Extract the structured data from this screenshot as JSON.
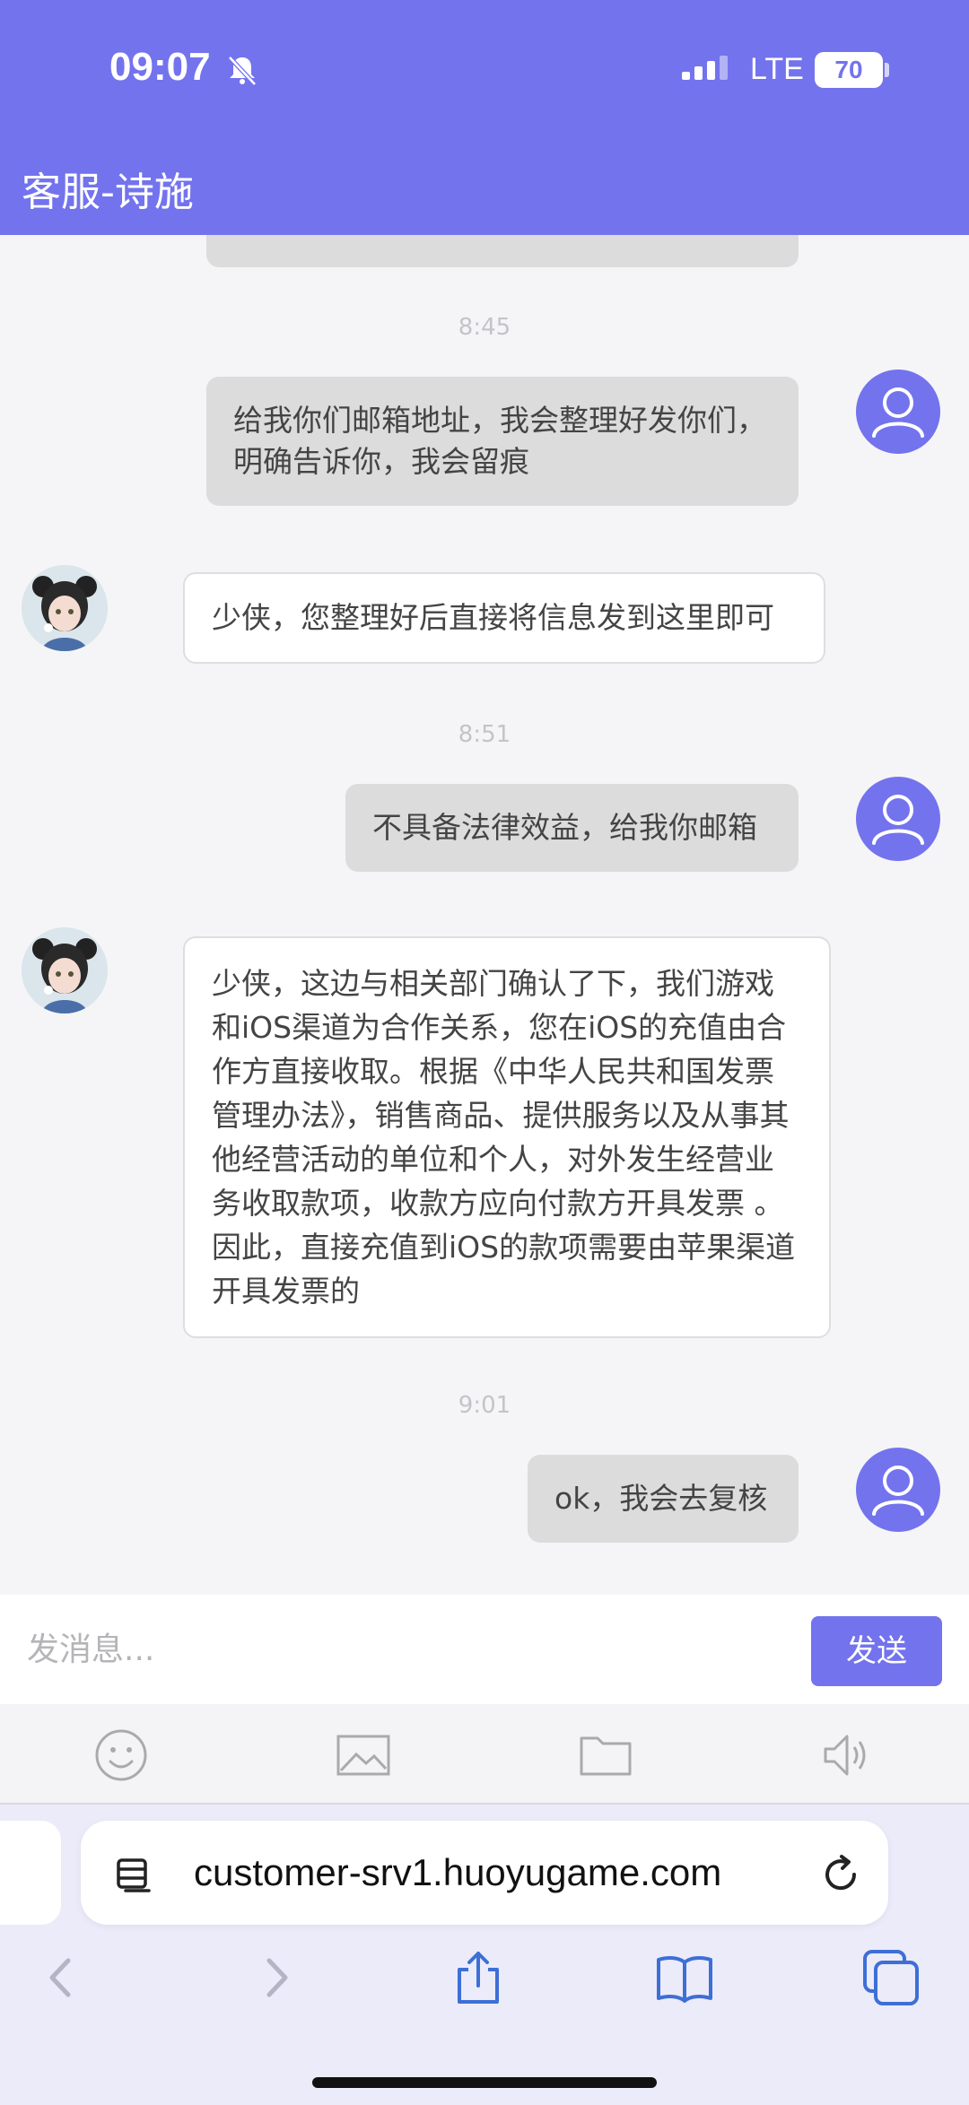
{
  "status_bar": {
    "time": "09:07",
    "network": "LTE",
    "battery": "70"
  },
  "header": {
    "title": "客服-诗施"
  },
  "messages": [
    {
      "type": "timestamp",
      "text": "8:45"
    },
    {
      "type": "user",
      "text": "给我你们邮箱地址，我会整理好发你们，明确告诉你，我会留痕"
    },
    {
      "type": "agent",
      "text": "少侠，您整理好后直接将信息发到这里即可"
    },
    {
      "type": "timestamp",
      "text": "8:51"
    },
    {
      "type": "user",
      "text": "不具备法律效益，给我你邮箱"
    },
    {
      "type": "agent",
      "text": "少侠，这边与相关部门确认了下，我们游戏和iOS渠道为合作关系，您在iOS的充值由合作方直接收取。根据《中华人民共和国发票管理办法》，销售商品、提供服务以及从事其他经营活动的单位和个人，对外发生经营业务收取款项，收款方应向付款方开具发票 。因此，直接充值到iOS的款项需要由苹果渠道开具发票的"
    },
    {
      "type": "timestamp",
      "text": "9:01"
    },
    {
      "type": "user",
      "text": "ok，我会去复核"
    }
  ],
  "input": {
    "placeholder": "发消息...",
    "send_label": "发送"
  },
  "toolbar": {
    "icons": [
      "emoji-icon",
      "image-icon",
      "folder-icon",
      "speaker-icon"
    ]
  },
  "browser": {
    "url": "customer-srv1.huoyugame.com"
  },
  "colors": {
    "accent": "#7373ee",
    "user_bubble": "#dcdcdc",
    "background": "#f5f5f7"
  }
}
